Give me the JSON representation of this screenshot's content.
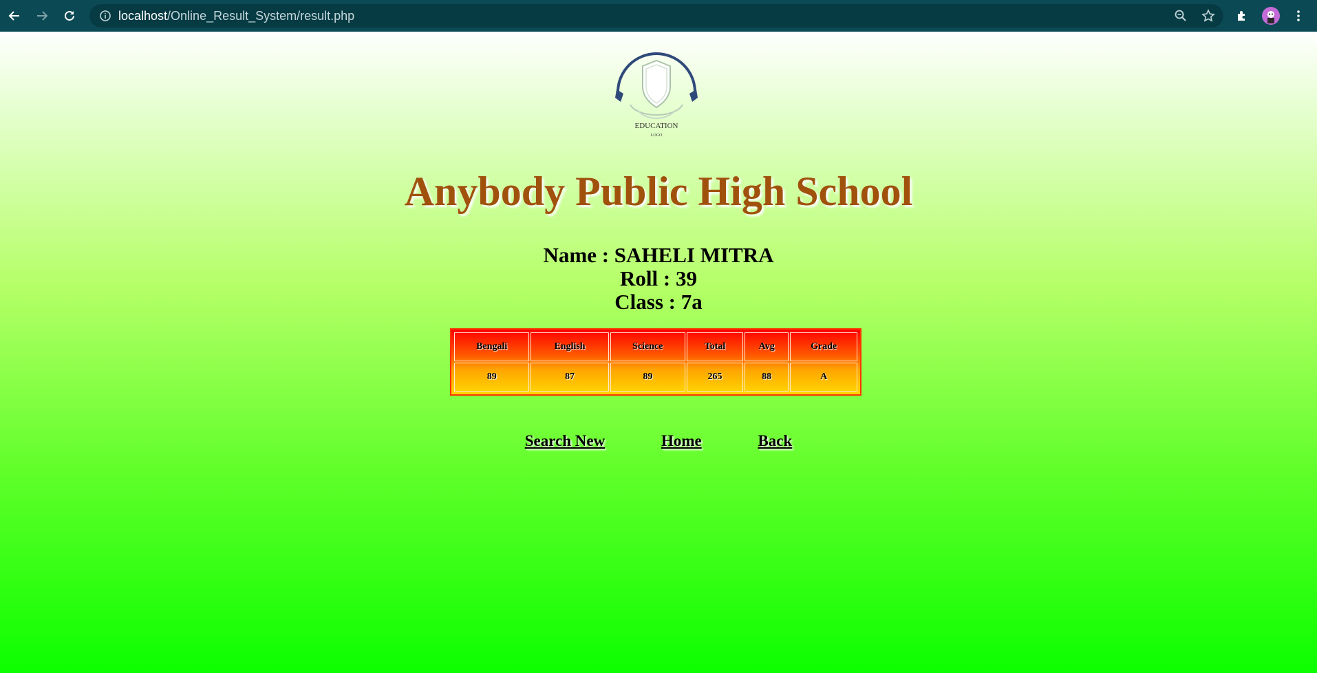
{
  "browser": {
    "url_host": "localhost",
    "url_path": "/Online_Result_System/result.php",
    "icons": [
      "back-arrow-icon",
      "forward-arrow-icon",
      "reload-icon",
      "info-icon",
      "zoom-icon",
      "star-icon",
      "extensions-icon",
      "profile-avatar",
      "menu-dots-icon"
    ]
  },
  "logo": {
    "line1": "EDUCATION",
    "line2": "LOGO"
  },
  "school_name": "Anybody Public High School",
  "student": {
    "name": "Name : SAHELI MITRA",
    "roll": "Roll : 39",
    "class": "Class : 7a"
  },
  "results": {
    "headers": [
      "Bengali",
      "English",
      "Science",
      "Total",
      "Avg",
      "Grade"
    ],
    "values": [
      "89",
      "87",
      "89",
      "265",
      "88",
      "A"
    ]
  },
  "links": {
    "search_new": "Search New",
    "home": "Home",
    "back": "Back"
  },
  "colors": {
    "title": "#a0520d",
    "toolbar": "#0b4a55",
    "table_border": "#ff3300"
  }
}
